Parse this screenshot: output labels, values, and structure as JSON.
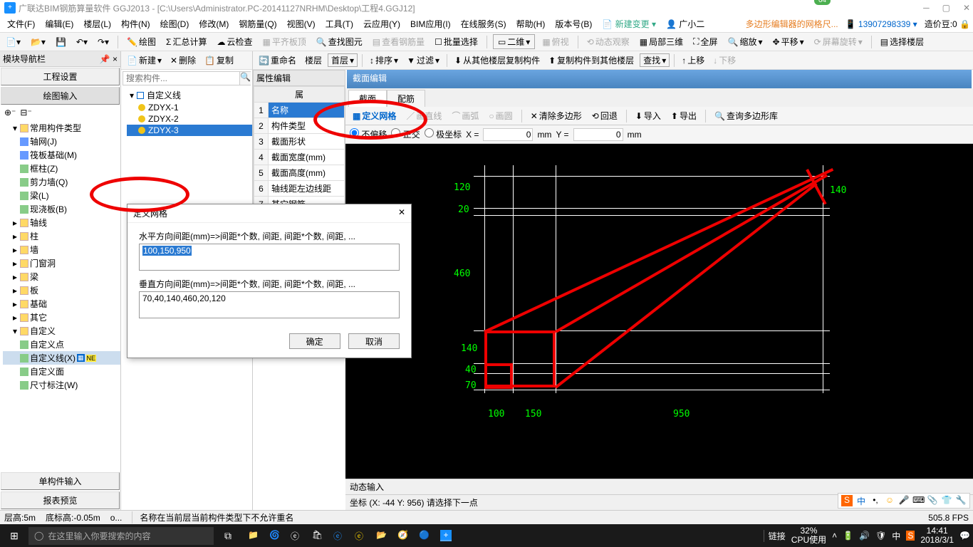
{
  "title": "广联达BIM钢筋算量软件 GGJ2013 - [C:\\Users\\Administrator.PC-20141127NRHM\\Desktop\\工程4.GGJ12]",
  "badge64": "64",
  "menu": [
    "文件(F)",
    "编辑(E)",
    "楼层(L)",
    "构件(N)",
    "绘图(D)",
    "修改(M)",
    "钢筋量(Q)",
    "视图(V)",
    "工具(T)",
    "云应用(Y)",
    "BIM应用(I)",
    "在线服务(S)",
    "帮助(H)",
    "版本号(B)"
  ],
  "menuExtra": {
    "newChange": "新建变更",
    "user": "广小二",
    "poly": "多边形编辑器的网格尺...",
    "phone": "13907298339",
    "coin": "造价豆:0"
  },
  "tb1": {
    "draw": "绘图",
    "sum": "汇总计算",
    "cloud": "云检查",
    "flat": "平齐板顶",
    "find": "查找图元",
    "rebar": "查看钢筋量",
    "batch": "批量选择",
    "dim2d": "二维",
    "bird": "俯视",
    "dyn": "动态观察",
    "local3d": "局部三维",
    "full": "全屏",
    "zoom": "缩放",
    "pan": "平移",
    "rot": "屏幕旋转",
    "selfloor": "选择楼层"
  },
  "midTb": {
    "new": "新建",
    "del": "删除",
    "copy": "复制",
    "rename": "重命名",
    "floor": "楼层",
    "first": "首层",
    "sort": "排序",
    "filter": "过滤",
    "copyFrom": "从其他楼层复制构件",
    "copyTo": "复制构件到其他楼层",
    "search": "查找",
    "up": "上移",
    "down": "下移"
  },
  "leftPanel": {
    "title": "模块导航栏",
    "proj": "工程设置",
    "draw": "绘图输入",
    "single": "单构件输入",
    "preview": "报表预览"
  },
  "tree": {
    "cat": "常用构件类型",
    "items": [
      "轴网(J)",
      "筏板基础(M)",
      "框柱(Z)",
      "剪力墙(Q)",
      "梁(L)",
      "现浇板(B)"
    ],
    "nodes": [
      "轴线",
      "柱",
      "墙",
      "门窗洞",
      "梁",
      "板",
      "基础",
      "其它"
    ],
    "custom": "自定义",
    "customItems": [
      "自定义点",
      "自定义线(X)",
      "自定义面",
      "尺寸标注(W)"
    ]
  },
  "search": {
    "placeholder": "搜索构件..."
  },
  "objTree": {
    "root": "自定义线",
    "items": [
      "ZDYX-1",
      "ZDYX-2",
      "ZDYX-3"
    ]
  },
  "prop": {
    "title": "属性编辑",
    "rows": [
      "名称",
      "构件类型",
      "截面形状",
      "截面宽度(mm)",
      "截面高度(mm)",
      "轴线距左边线距",
      "其它钢筋"
    ]
  },
  "editor": {
    "hdr": "截面编辑",
    "tabs": [
      "截面",
      "配筋"
    ],
    "tb": {
      "grid": "定义网格",
      "line": "画直线",
      "arc": "画弧",
      "circle": "画圆",
      "clear": "清除多边形",
      "back": "回退",
      "imp": "导入",
      "exp": "导出",
      "lib": "查询多边形库"
    },
    "tb2": {
      "noshift": "不偏移",
      "ortho": "正交",
      "polar": "极坐标",
      "x": "X =",
      "y": "Y =",
      "mm": "mm",
      "xv": "0",
      "yv": "0"
    },
    "dims": {
      "top1": "120",
      "top2": "20",
      "left460": "460",
      "left140": "140",
      "left40": "40",
      "left70": "70",
      "bot100": "100",
      "bot150": "150",
      "bot950": "950",
      "right140": "140"
    },
    "dyn": "动态输入",
    "coord": "坐标 (X: -44 Y: 956)  请选择下一点"
  },
  "dialog": {
    "title": "定义网格",
    "h": "水平方向间距(mm)=>间距*个数, 间距, 间距*个数, 间距, ...",
    "hv": "100,150,950",
    "v": "垂直方向间距(mm)=>间距*个数, 间距, 间距*个数, 间距, ...",
    "vv": "70,40,140,460,20,120",
    "ok": "确定",
    "cancel": "取消"
  },
  "status": {
    "h": "层高:5m",
    "bh": "底标高:-0.05m",
    "o": "o...",
    "msg": "名称在当前层当前构件类型下不允许重名",
    "fps": "505.8 FPS"
  },
  "taskbar": {
    "search": "在这里输入你要搜索的内容",
    "link": "链接",
    "cpu": "32%",
    "cpuL": "CPU使用",
    "time": "14:41",
    "date": "2018/3/1"
  }
}
